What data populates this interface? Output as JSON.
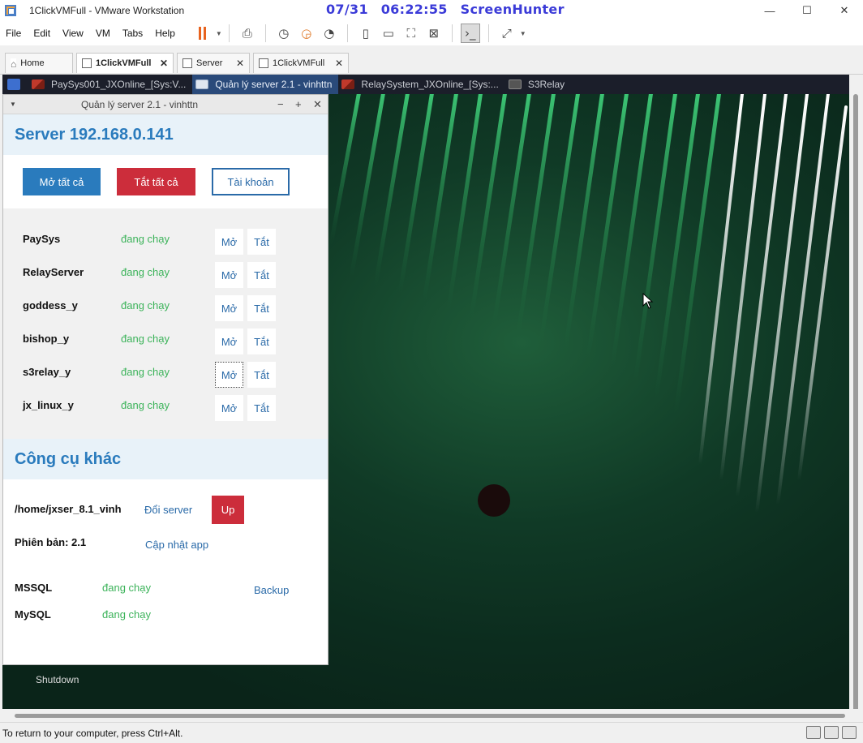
{
  "window": {
    "title": "1ClickVMFull - VMware Workstation",
    "controls": [
      "—",
      "☐",
      "✕"
    ]
  },
  "screenhunter": {
    "date": "07/31",
    "time": "06:22:55",
    "brand": "ScreenHunter"
  },
  "menu": [
    "File",
    "Edit",
    "View",
    "VM",
    "Tabs",
    "Help"
  ],
  "toolbar": {
    "icons": [
      "pause-icon",
      "send-ctrl-alt-del-icon",
      "snapshot-icon",
      "revert-snapshot-icon",
      "snapshot-manager-icon",
      "library-icon",
      "console-view-icon",
      "fit-guest-icon",
      "unity-icon",
      "terminal-icon",
      "fullscreen-icon"
    ]
  },
  "tabs": [
    {
      "label": "Home",
      "icon": "home-icon",
      "active": false
    },
    {
      "label": "1ClickVMFull",
      "icon": "vm-icon",
      "active": true
    },
    {
      "label": "Server",
      "icon": "vm-icon",
      "active": false
    },
    {
      "label": "1ClickVMFull",
      "icon": "vm-icon",
      "active": false
    }
  ],
  "guest_taskbar": [
    {
      "label": "PaySys001_JXOnline_[Sys:V...",
      "icon": "red"
    },
    {
      "label": "Quản lý server 2.1 - vinhttn",
      "icon": "blue",
      "active": true
    },
    {
      "label": "RelaySystem_JXOnline_[Sys:...",
      "icon": "red"
    },
    {
      "label": "S3Relay",
      "icon": "term"
    }
  ],
  "desktop": {
    "shutdown_label": "Shutdown"
  },
  "app": {
    "title": "Quản lý server 2.1 - vinhttn",
    "controls": [
      "−",
      "+",
      "✕"
    ],
    "server_heading": "Server 192.168.0.141",
    "buttons": {
      "open_all": "Mở tất cả",
      "close_all": "Tắt tất cả",
      "accounts": "Tài khoản"
    },
    "services": [
      {
        "name": "PaySys",
        "status": "đang chạy",
        "open": "Mở",
        "close": "Tắt"
      },
      {
        "name": "RelayServer",
        "status": "đang chạy",
        "open": "Mở",
        "close": "Tắt"
      },
      {
        "name": "goddess_y",
        "status": "đang chạy",
        "open": "Mở",
        "close": "Tắt"
      },
      {
        "name": "bishop_y",
        "status": "đang chạy",
        "open": "Mở",
        "close": "Tắt"
      },
      {
        "name": "s3relay_y",
        "status": "đang chạy",
        "open": "Mở",
        "close": "Tắt"
      },
      {
        "name": "jx_linux_y",
        "status": "đang chạy",
        "open": "Mở",
        "close": "Tắt"
      }
    ],
    "tools_heading": "Công cụ khác",
    "tools": {
      "path": "/home/jxser_8.1_vinh",
      "change_server": "Đổi server",
      "up": "Up",
      "version_label": "Phiên bản: 2.1",
      "update_app": "Cập nhật app",
      "mssql_label": "MSSQL",
      "mssql_status": "đang chạy",
      "mysql_label": "MySQL",
      "mysql_status": "đang chạy",
      "backup": "Backup"
    }
  },
  "statusbar": {
    "text": "To return to your computer, press Ctrl+Alt."
  },
  "colors": {
    "accent_blue": "#2a7bbd",
    "danger_red": "#cc2d3b",
    "running_green": "#3cb35a",
    "screenhunter_blue": "#3b3bd8",
    "pause_orange": "#e8631f"
  }
}
